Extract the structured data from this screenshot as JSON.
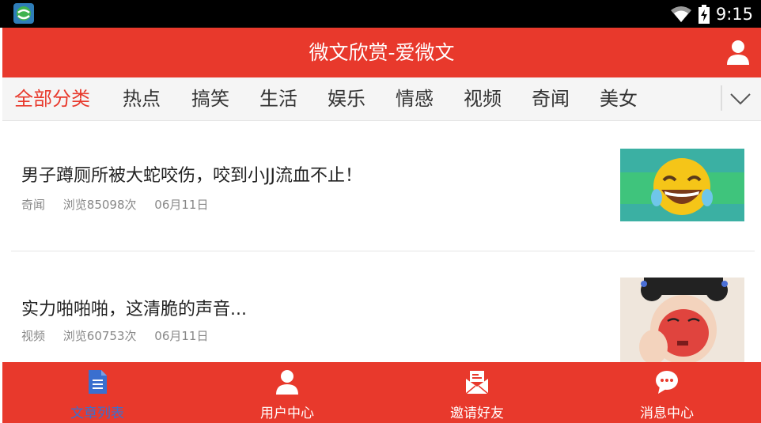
{
  "status_bar": {
    "time": "9:15",
    "wifi_icon": "wifi-icon",
    "battery_icon": "battery-charging-icon"
  },
  "app_bar": {
    "title": "微文欣赏-爱微文",
    "user_icon": "user-icon"
  },
  "categories": [
    {
      "label": "全部分类",
      "active": true
    },
    {
      "label": "热点",
      "active": false
    },
    {
      "label": "搞笑",
      "active": false
    },
    {
      "label": "生活",
      "active": false
    },
    {
      "label": "娱乐",
      "active": false
    },
    {
      "label": "情感",
      "active": false
    },
    {
      "label": "视频",
      "active": false
    },
    {
      "label": "奇闻",
      "active": false
    },
    {
      "label": "美女",
      "active": false
    }
  ],
  "articles": [
    {
      "title": "男子蹲厕所被大蛇咬伤，咬到小JJ流血不止！",
      "category": "奇闻",
      "views": "浏览85098次",
      "date": "06月11日",
      "thumb": "laughing-emoji"
    },
    {
      "title": "实力啪啪啪，这清脆的声音...",
      "category": "视频",
      "views": "浏览60753次",
      "date": "06月11日",
      "thumb": "opera-face-illustration"
    }
  ],
  "bottom_tabs": [
    {
      "label": "文章列表",
      "icon": "document-icon",
      "active": true
    },
    {
      "label": "用户中心",
      "icon": "user-icon",
      "active": false
    },
    {
      "label": "邀请好友",
      "icon": "mail-invite-icon",
      "active": false
    },
    {
      "label": "消息中心",
      "icon": "chat-bubble-icon",
      "active": false
    }
  ],
  "colors": {
    "primary": "#e8392c",
    "active_tab": "#3a6fcf",
    "text": "#222222",
    "meta": "#888888"
  }
}
